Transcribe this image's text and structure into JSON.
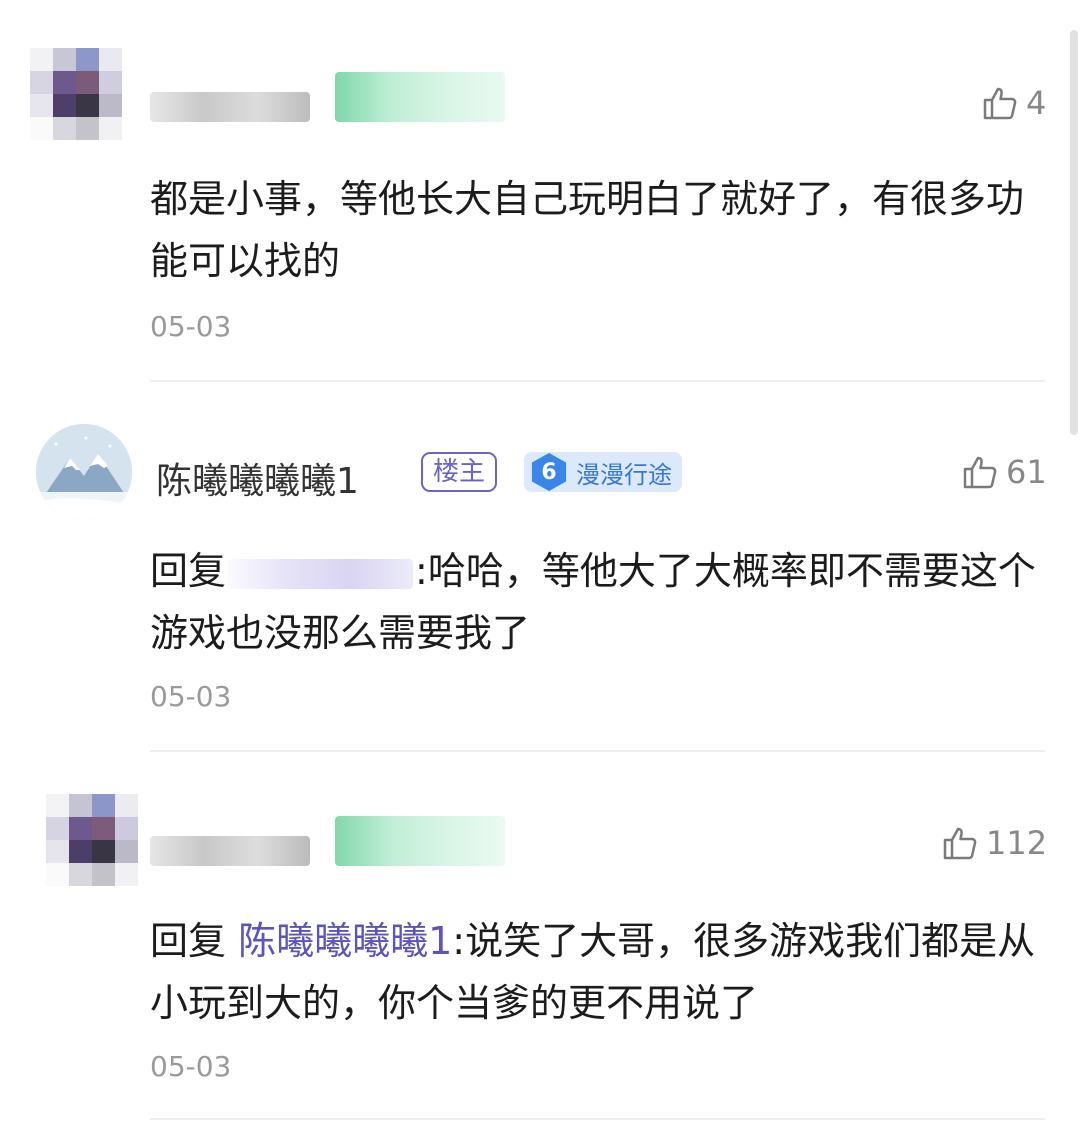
{
  "comments": [
    {
      "user_name": "",
      "likes": "4",
      "text": "都是小事，等他长大自己玩明白了就好了，有很多功能可以找的",
      "date": "05-03"
    },
    {
      "user_name": "陈曦曦曦曦1",
      "owner_badge": "楼主",
      "level_number": "6",
      "level_name": "漫漫行途",
      "likes": "61",
      "reply_prefix": "回复",
      "text_after_mention": ":哈哈，等他大了大概率即不需要这个游戏也没那么需要我了",
      "date": "05-03"
    },
    {
      "user_name": "",
      "likes": "112",
      "reply_prefix": "回复",
      "reply_to": "陈曦曦曦曦1",
      "text_after_mention": ":说笑了大哥，很多游戏我们都是从小玩到大的，你个当爹的更不用说了",
      "date": "05-03"
    }
  ],
  "icons": {
    "like": "thumbs-up-icon",
    "avatar_2": "snow-mountain-avatar"
  },
  "colors": {
    "owner_badge": "#6a64c8",
    "level_badge": "#3a86e8",
    "mention": "#5b54c0",
    "date": "#9a9a9a"
  }
}
